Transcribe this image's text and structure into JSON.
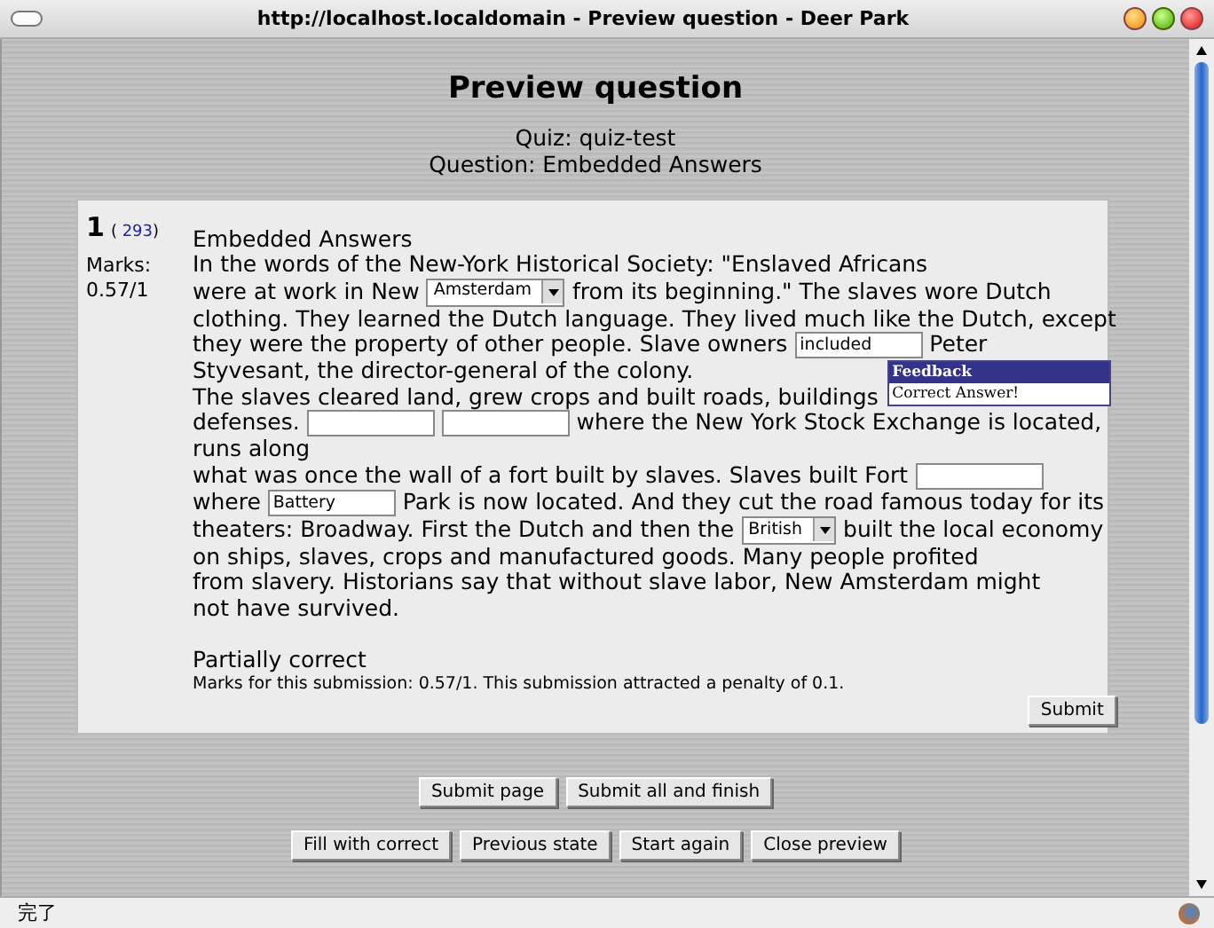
{
  "window": {
    "title": "http://localhost.localdomain - Preview question - Deer Park"
  },
  "heading": "Preview question",
  "quiz_line": "Quiz: quiz-test",
  "question_line": "Question: Embedded Answers",
  "question": {
    "number": "1",
    "id_open": "(",
    "id": "293",
    "id_close": ")",
    "marks_label": "Marks:",
    "marks": "0.57/1",
    "name": "Embedded Answers",
    "body": [
      {
        "kind": "text",
        "text": "In the words of the New-York Historical Society: \"Enslaved Africans"
      },
      {
        "kind": "break"
      },
      {
        "kind": "text",
        "text": "were at work in New"
      },
      {
        "kind": "select",
        "value": "Amsterdam"
      },
      {
        "kind": "text",
        "text": "from its beginning.\" The slaves wore Dutch"
      },
      {
        "kind": "break"
      },
      {
        "kind": "text",
        "text": "clothing. They learned the Dutch language. They lived much like the Dutch, except"
      },
      {
        "kind": "break"
      },
      {
        "kind": "text",
        "text": "they were the property of other people. Slave owners"
      },
      {
        "kind": "input",
        "value": "included",
        "feedback": {
          "title": "Feedback",
          "text": "Correct Answer!"
        }
      },
      {
        "kind": "text",
        "text": "Peter"
      },
      {
        "kind": "break"
      },
      {
        "kind": "text",
        "text": "Styvesant, the director-general of the colony."
      },
      {
        "kind": "break"
      },
      {
        "kind": "text",
        "text": "The slaves cleared land, grew crops and built roads, buildings"
      },
      {
        "kind": "break"
      },
      {
        "kind": "text",
        "text": "defenses."
      },
      {
        "kind": "input"
      },
      {
        "kind": "input"
      },
      {
        "kind": "text",
        "text": "where the New York Stock Exchange is located,"
      },
      {
        "kind": "break"
      },
      {
        "kind": "text",
        "text": "runs along"
      },
      {
        "kind": "break"
      },
      {
        "kind": "text",
        "text": "what was once the wall of a fort built by slaves. Slaves built Fort"
      },
      {
        "kind": "input"
      },
      {
        "kind": "break"
      },
      {
        "kind": "text",
        "text": "where"
      },
      {
        "kind": "input",
        "value": "Battery"
      },
      {
        "kind": "text",
        "text": "Park is now located. And they cut the road famous today for its"
      },
      {
        "kind": "break"
      },
      {
        "kind": "text",
        "text": "theaters: Broadway. First the Dutch and then the"
      },
      {
        "kind": "select",
        "value": "British"
      },
      {
        "kind": "text",
        "text": "built the local economy"
      },
      {
        "kind": "break"
      },
      {
        "kind": "text",
        "text": "on ships, slaves, crops and manufactured goods. Many people profited"
      },
      {
        "kind": "break"
      },
      {
        "kind": "text",
        "text": "from slavery. Historians say that without slave labor, New Amsterdam might"
      },
      {
        "kind": "break"
      },
      {
        "kind": "text",
        "text": "not have survived."
      }
    ],
    "grade": "Partially correct",
    "grade_detail": "Marks for this submission: 0.57/1. This submission attracted a penalty of 0.1.",
    "submit": "Submit"
  },
  "button_rows": [
    [
      "Submit page",
      "Submit all and finish"
    ],
    [
      "Fill with correct",
      "Previous state",
      "Start again",
      "Close preview"
    ]
  ],
  "status_bar": {
    "text": "完了"
  }
}
